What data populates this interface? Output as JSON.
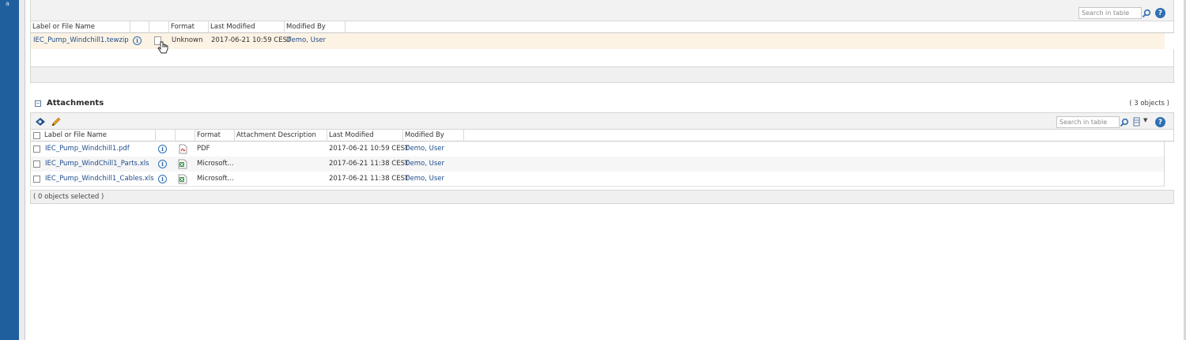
{
  "app": {
    "rail_glyph": "a"
  },
  "primary_table": {
    "search_placeholder": "Search in table",
    "columns": [
      "Label or File Name",
      "",
      "",
      "Format",
      "Last Modified",
      "Modified By"
    ],
    "rows": [
      {
        "name": "IEC_Pump_Windchill1.tewzip",
        "format": "Unknown",
        "modified": "2017-06-21 10:59 CEST",
        "by": "Demo, User"
      }
    ],
    "row_highlight": "#fdf3e4"
  },
  "attachments": {
    "title": "Attachments",
    "count": "( 3 objects )",
    "search_placeholder": "Search in table",
    "columns": [
      "Label or File Name",
      "",
      "",
      "Format",
      "Attachment Description",
      "Last Modified",
      "Modified By"
    ],
    "rows": [
      {
        "name": "IEC_Pump_Windchill1.pdf",
        "icon": "pdf-icon",
        "format": "PDF",
        "description": "",
        "modified": "2017-06-21 10:59 CEST",
        "by": "Demo, User"
      },
      {
        "name": "IEC_Pump_WindChill1_Parts.xls",
        "icon": "excel-icon",
        "format": "Microsoft...",
        "description": "",
        "modified": "2017-06-21 11:38 CEST",
        "by": "Demo, User"
      },
      {
        "name": "IEC_Pump_Windchill1_Cables.xls",
        "icon": "excel-icon",
        "format": "Microsoft...",
        "description": "",
        "modified": "2017-06-21 11:38 CEST",
        "by": "Demo, User"
      }
    ],
    "footer": "( 0 objects selected )"
  },
  "colors": {
    "rail": "#1f5f9e",
    "link": "#1e4d8c",
    "accent": "#2f6fb3"
  }
}
